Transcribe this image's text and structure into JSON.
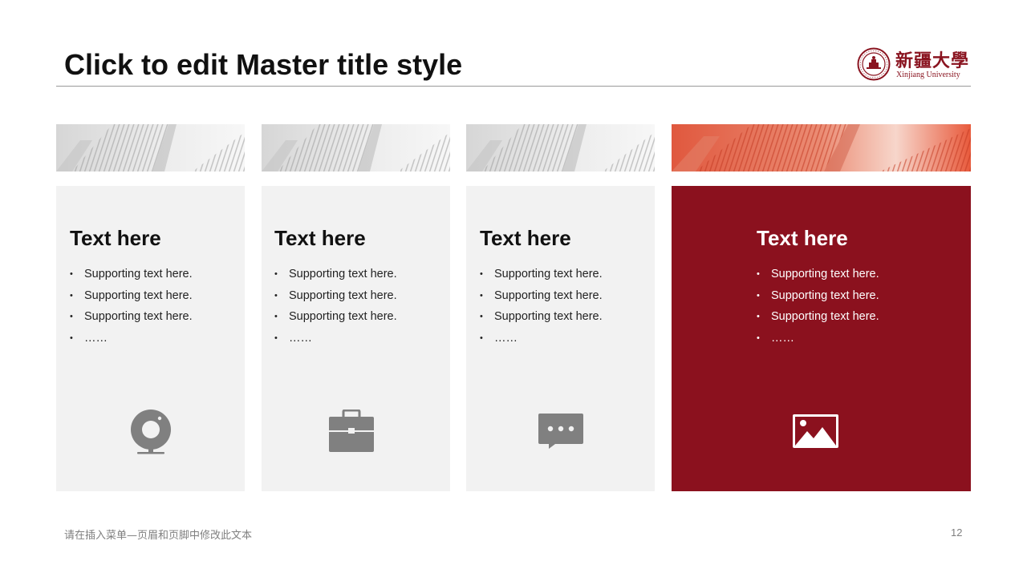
{
  "slide": {
    "title": "Click to edit Master title style",
    "footer_text": "请在插入菜单—页眉和页脚中修改此文本",
    "page_number": "12"
  },
  "logo": {
    "name_cn": "新疆大學",
    "name_en": "Xinjiang University",
    "emblem_icon": "university-seal-icon"
  },
  "colors": {
    "accent": "#8b111e",
    "accent_banner": "#e0583e",
    "card_gray": "#f2f2f2",
    "icon_gray": "#808080",
    "title": "#111111"
  },
  "cards": [
    {
      "title": "Text here",
      "bullets": [
        "Supporting text here.",
        "Supporting text here.",
        "Supporting text here.",
        "……"
      ],
      "icon": "webcam-icon",
      "highlighted": false
    },
    {
      "title": "Text here",
      "bullets": [
        "Supporting text here.",
        "Supporting text here.",
        "Supporting text here.",
        "……"
      ],
      "icon": "briefcase-icon",
      "highlighted": false
    },
    {
      "title": "Text here",
      "bullets": [
        "Supporting text here.",
        "Supporting text here.",
        "Supporting text here.",
        "……"
      ],
      "icon": "chat-bubble-icon",
      "highlighted": false
    },
    {
      "title": "Text here",
      "bullets": [
        "Supporting text here.",
        "Supporting text here.",
        "Supporting text here.",
        "……"
      ],
      "icon": "image-icon",
      "highlighted": true
    }
  ]
}
